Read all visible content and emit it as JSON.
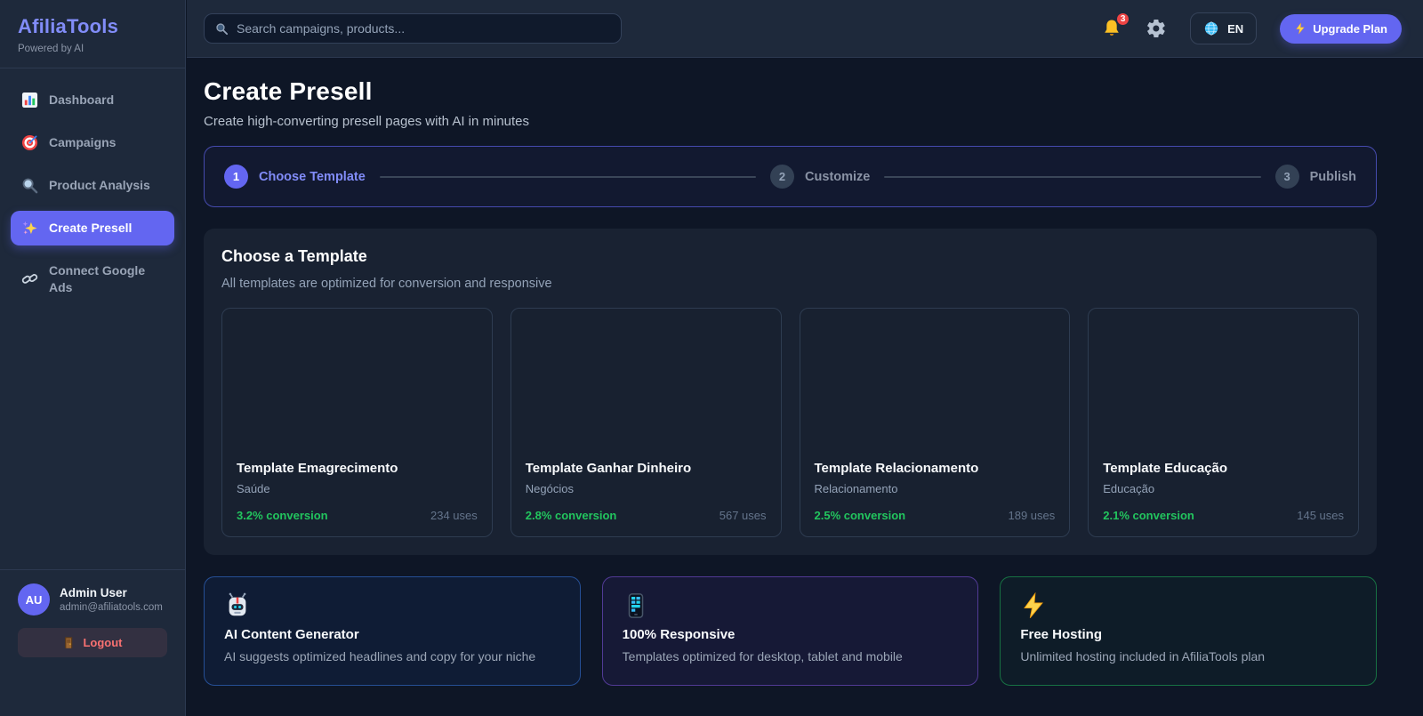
{
  "brand": {
    "name": "AfiliaTools",
    "tagline": "Powered by AI"
  },
  "sidebar": {
    "items": [
      {
        "icon": "bar-chart-icon",
        "label": "Dashboard",
        "active": false
      },
      {
        "icon": "target-icon",
        "label": "Campaigns",
        "active": false
      },
      {
        "icon": "magnifier-icon",
        "label": "Product Analysis",
        "active": false
      },
      {
        "icon": "sparkles-icon",
        "label": "Create Presell",
        "active": true
      },
      {
        "icon": "link-icon",
        "label": "Connect Google Ads",
        "active": false
      }
    ]
  },
  "topbar": {
    "search_placeholder": "Search campaigns, products...",
    "notification_count": "3",
    "icons": [
      "search-icon",
      "bell-icon",
      "gear-icon",
      "globe-icon",
      "bolt-icon"
    ],
    "language": "EN",
    "upgrade_label": "Upgrade Plan"
  },
  "page": {
    "title": "Create Presell",
    "subtitle": "Create high-converting presell pages with AI in minutes"
  },
  "stepper": {
    "steps": [
      {
        "number": "1",
        "label": "Choose Template",
        "active": true
      },
      {
        "number": "2",
        "label": "Customize",
        "active": false
      },
      {
        "number": "3",
        "label": "Publish",
        "active": false
      }
    ]
  },
  "templates": {
    "heading": "Choose a Template",
    "subheading": "All templates are optimized for conversion and responsive",
    "cards": [
      {
        "title": "Template Emagrecimento",
        "category": "Saúde",
        "conversion": "3.2% conversion",
        "uses": "234 uses"
      },
      {
        "title": "Template Ganhar Dinheiro",
        "category": "Negócios",
        "conversion": "2.8% conversion",
        "uses": "567 uses"
      },
      {
        "title": "Template Relacionamento",
        "category": "Relacionamento",
        "conversion": "2.5% conversion",
        "uses": "189 uses"
      },
      {
        "title": "Template Educação",
        "category": "Educação",
        "conversion": "2.1% conversion",
        "uses": "145 uses"
      }
    ]
  },
  "features": [
    {
      "icon": "robot-icon",
      "accent": "blue",
      "title": "AI Content Generator",
      "description": "AI suggests optimized headlines and copy for your niche"
    },
    {
      "icon": "phone-icon",
      "accent": "purple",
      "title": "100% Responsive",
      "description": "Templates optimized for desktop, tablet and mobile"
    },
    {
      "icon": "bolt-icon",
      "accent": "green",
      "title": "Free Hosting",
      "description": "Unlimited hosting included in AfiliaTools plan"
    }
  ],
  "user": {
    "initials": "AU",
    "name": "Admin User",
    "email": "admin@afiliatools.com",
    "logout_label": "Logout",
    "logout_icon": "door-icon"
  },
  "colors": {
    "accent_indigo": "#6366f1",
    "accent_indigo_light": "#818cf8",
    "success_green": "#22c55e",
    "danger_red": "#ef4444",
    "logout_red": "#f87171",
    "background": "#0e1626",
    "surface": "#1e293b",
    "panel": "#192232"
  }
}
